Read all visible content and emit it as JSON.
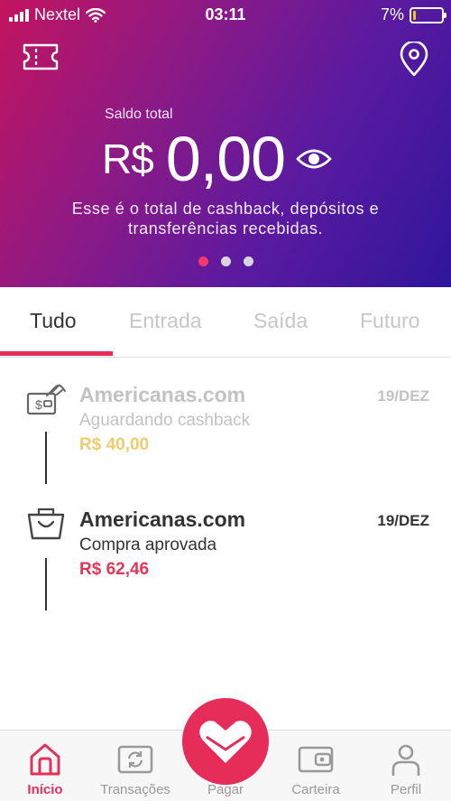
{
  "status_bar": {
    "carrier": "Nextel",
    "time": "03:11",
    "battery_percent": "7%",
    "battery_level": 0.07
  },
  "header": {
    "ticket_icon": "ticket-icon",
    "location_icon": "location-pin-icon"
  },
  "balance": {
    "label": "Saldo total",
    "currency": "R$",
    "value": "0,00",
    "visibility_icon": "eye-icon",
    "description_line1": "Esse é o total de cashback, depósitos e",
    "description_line2": "transferências recebidas.",
    "carousel_pages": 3,
    "carousel_active": 1
  },
  "tabs": [
    {
      "label": "Tudo",
      "active": true
    },
    {
      "label": "Entrada",
      "active": false
    },
    {
      "label": "Saída",
      "active": false
    },
    {
      "label": "Futuro",
      "active": false
    }
  ],
  "transactions": [
    {
      "merchant": "Americanas.com",
      "status": "Aguardando cashback",
      "amount": "R$ 40,00",
      "date": "19/DEZ",
      "icon": "cashback-hand-icon",
      "state": "pending"
    },
    {
      "merchant": "Americanas.com",
      "status": "Compra aprovada",
      "amount": "R$ 62,46",
      "date": "19/DEZ",
      "icon": "shopping-bag-icon",
      "state": "approved"
    }
  ],
  "bottom_nav": [
    {
      "label": "Início",
      "icon": "home-icon",
      "active": true
    },
    {
      "label": "Transações",
      "icon": "transactions-icon",
      "active": false
    },
    {
      "label": "Pagar",
      "icon": "pay-heart-icon",
      "active": false
    },
    {
      "label": "Carteira",
      "icon": "wallet-icon",
      "active": false
    },
    {
      "label": "Perfil",
      "icon": "profile-icon",
      "active": false
    }
  ],
  "colors": {
    "accent": "#e92b55",
    "gradient_start": "#c3145f",
    "gradient_end": "#2f169a",
    "pending_amount": "#f0cc6e"
  }
}
